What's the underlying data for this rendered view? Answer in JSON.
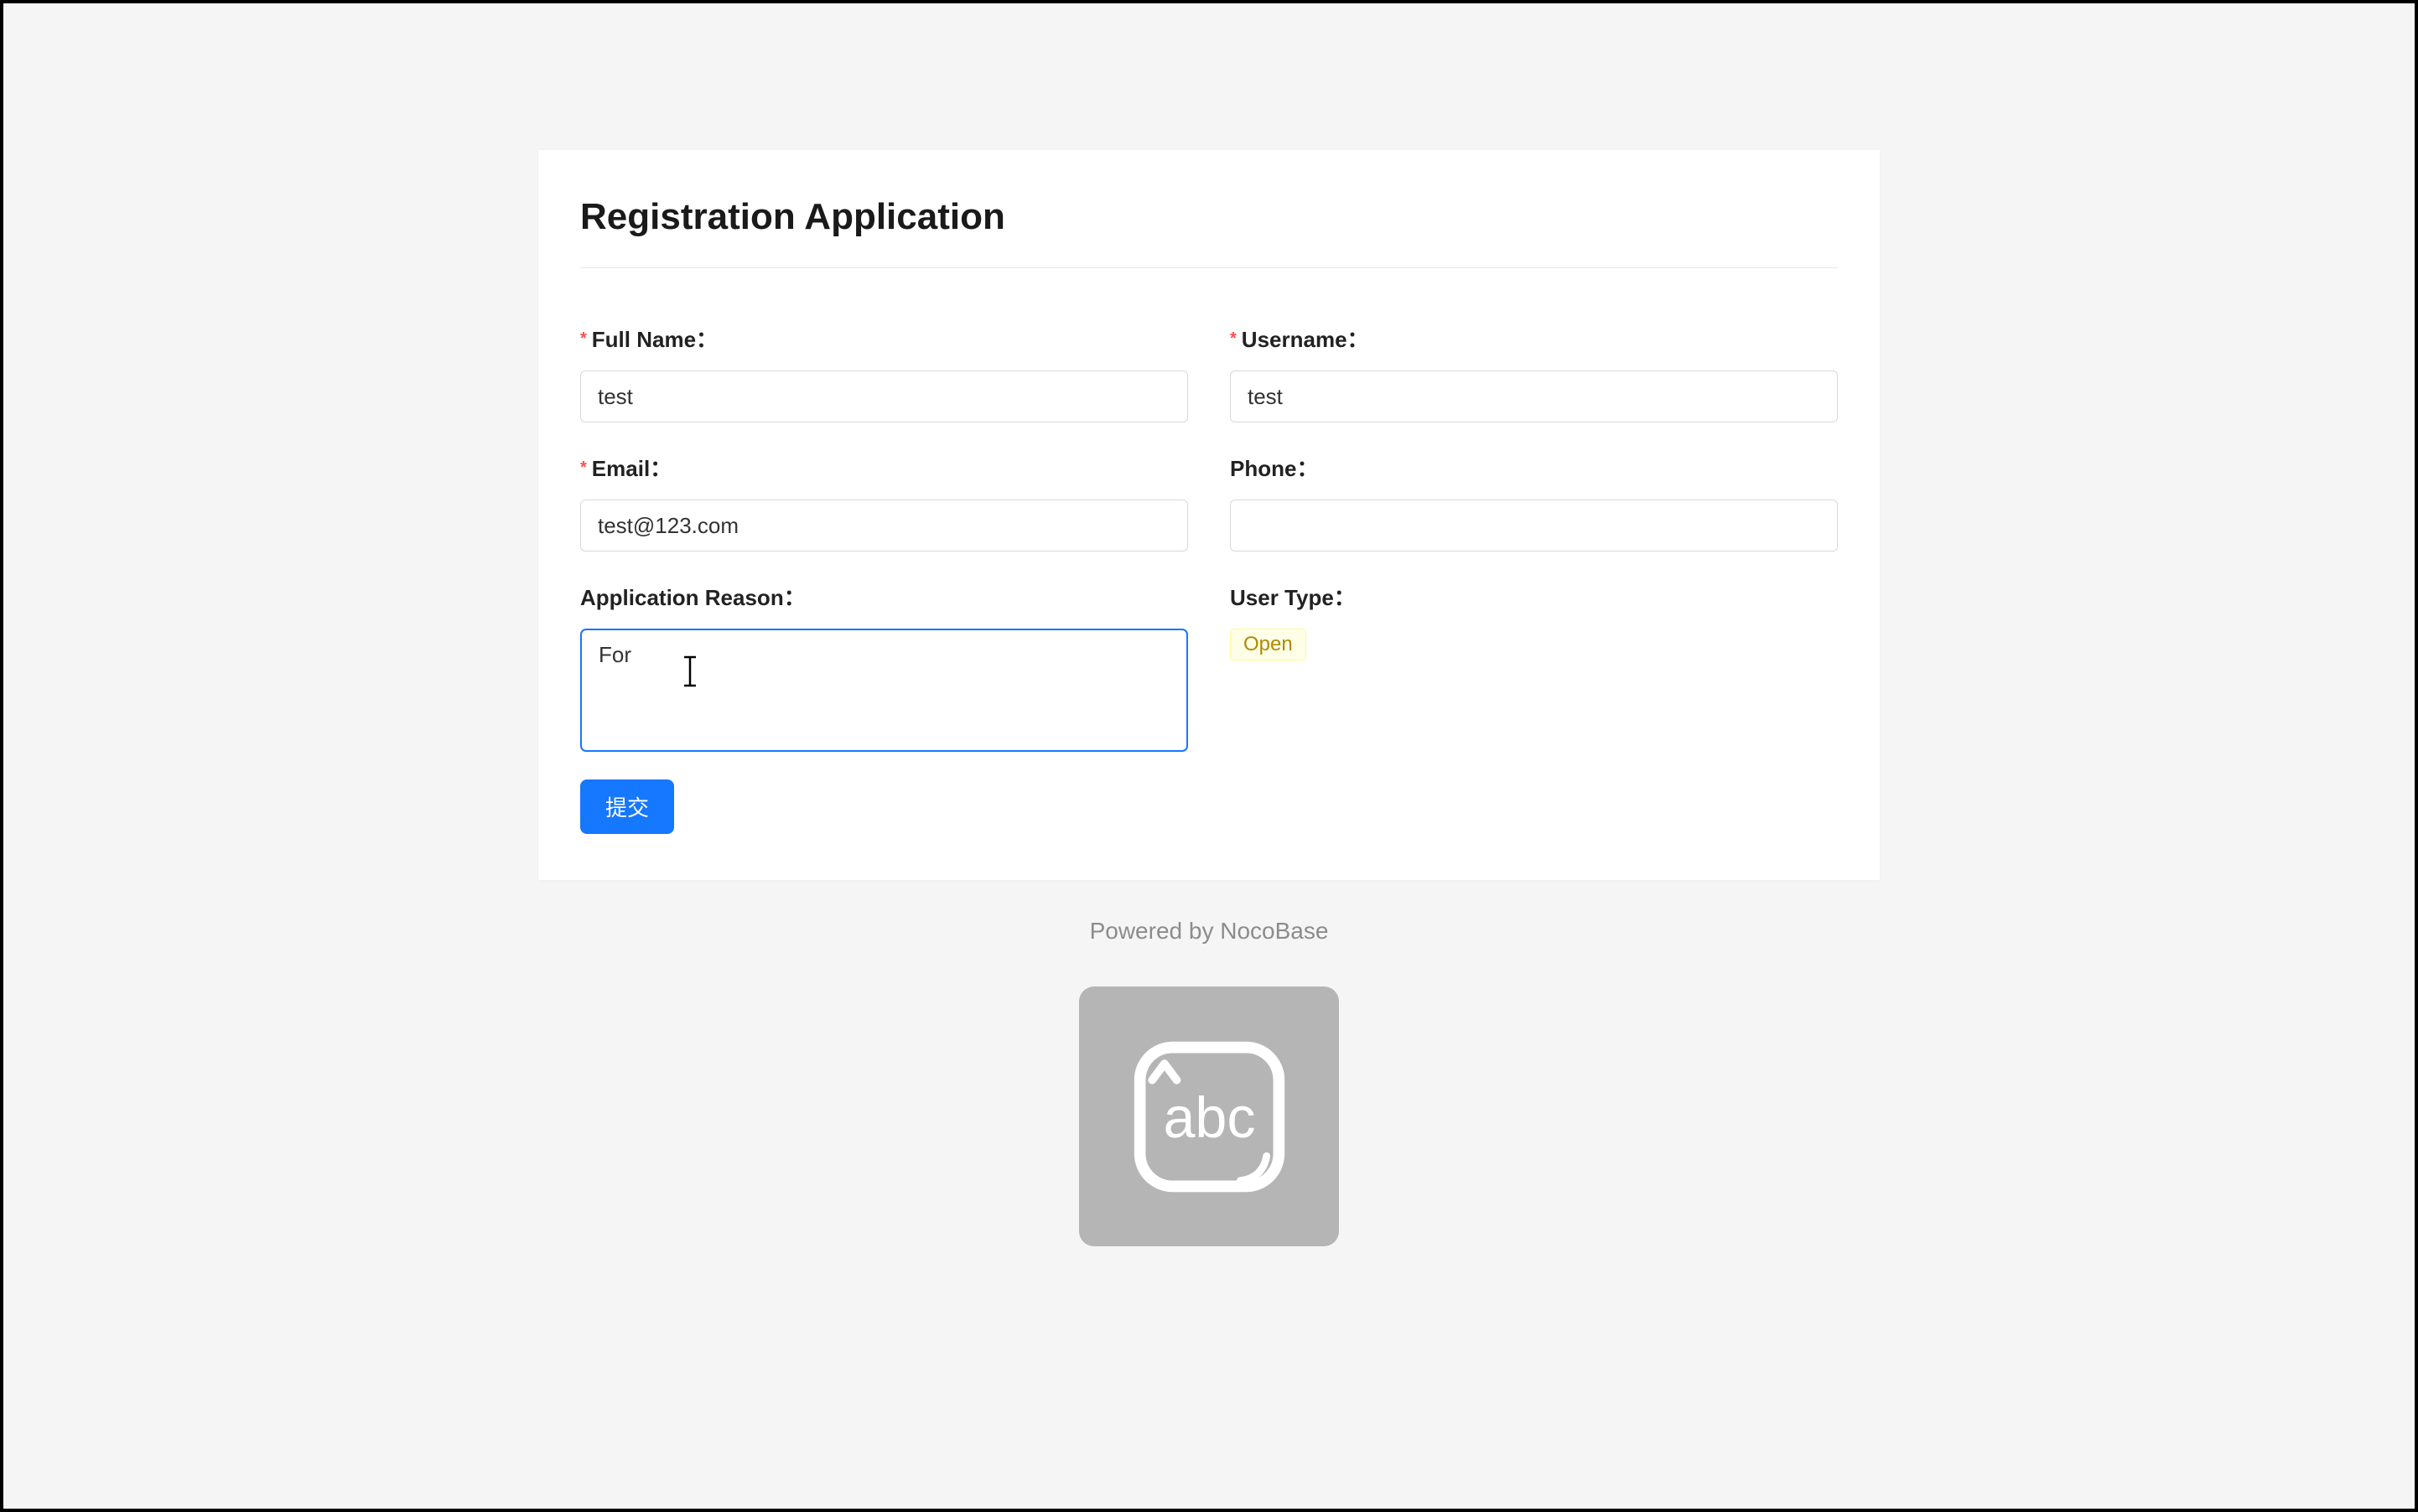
{
  "form": {
    "title": "Registration Application",
    "fields": {
      "fullname": {
        "label": "Full Name：",
        "required": true,
        "value": "test"
      },
      "username": {
        "label": "Username：",
        "required": true,
        "value": "test"
      },
      "email": {
        "label": "Email：",
        "required": true,
        "value": "test@123.com"
      },
      "phone": {
        "label": "Phone：",
        "required": false,
        "value": ""
      },
      "reason": {
        "label": "Application Reason：",
        "required": false,
        "value": "For "
      },
      "usertype": {
        "label": "User Type：",
        "required": false,
        "tag": "Open"
      }
    },
    "submit_label": "提交"
  },
  "footer": {
    "powered_by": "Powered by NocoBase"
  },
  "ime": {
    "text": "abc"
  }
}
